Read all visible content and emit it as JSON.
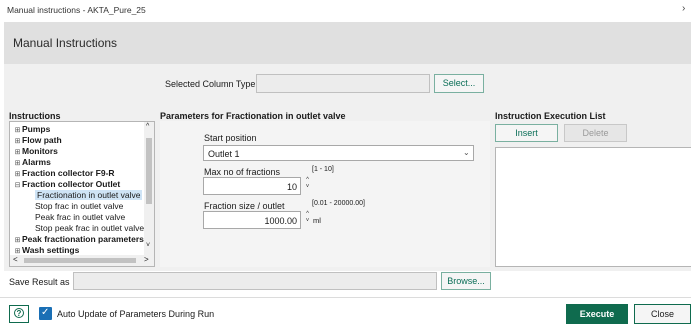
{
  "window": {
    "title": "Manual instructions - AKTA_Pure_25",
    "close_glyph": "›"
  },
  "header": {
    "title": "Manual Instructions"
  },
  "column_type": {
    "label": "Selected Column Type",
    "value": "",
    "select_label": "Select..."
  },
  "instructions": {
    "heading": "Instructions",
    "items": [
      {
        "label": "Pumps",
        "toggle": "⊞",
        "bold": true
      },
      {
        "label": "Flow path",
        "toggle": "⊞",
        "bold": true
      },
      {
        "label": "Monitors",
        "toggle": "⊞",
        "bold": true
      },
      {
        "label": "Alarms",
        "toggle": "⊞",
        "bold": true
      },
      {
        "label": "Fraction collector F9-R",
        "toggle": "⊞",
        "bold": true
      },
      {
        "label": "Fraction collector Outlet",
        "toggle": "⊟",
        "bold": true
      },
      {
        "label": "Fractionation in outlet valve",
        "child": true,
        "selected": true
      },
      {
        "label": "Stop frac in outlet valve",
        "child": true
      },
      {
        "label": "Peak frac in outlet valve",
        "child": true
      },
      {
        "label": "Stop peak frac in outlet valve",
        "child": true
      },
      {
        "label": "Peak fractionation parameters",
        "toggle": "⊞",
        "bold": true
      },
      {
        "label": "Wash settings",
        "toggle": "⊞",
        "bold": true
      }
    ]
  },
  "parameters": {
    "heading": "Parameters for Fractionation in outlet valve",
    "start_position": {
      "label": "Start position",
      "value": "Outlet 1"
    },
    "max_fractions": {
      "label": "Max no of fractions",
      "range": "[1 - 10]",
      "value": "10"
    },
    "fraction_size": {
      "label": "Fraction size / outlet",
      "range": "[0.01 - 20000.00]",
      "value": "1000.00",
      "unit": "ml"
    }
  },
  "execution_list": {
    "heading": "Instruction Execution List",
    "insert_label": "Insert",
    "delete_label": "Delete"
  },
  "save_result": {
    "label": "Save Result as",
    "value": "",
    "browse_label": "Browse..."
  },
  "footer": {
    "help_glyph": "?",
    "auto_update_label": "Auto Update of Parameters During Run",
    "auto_update_checked": true,
    "execute_label": "Execute",
    "close_label": "Close"
  },
  "colors": {
    "accent": "#0f6b4e",
    "selection": "#cfe4f6",
    "panel": "#f0f0f0"
  }
}
